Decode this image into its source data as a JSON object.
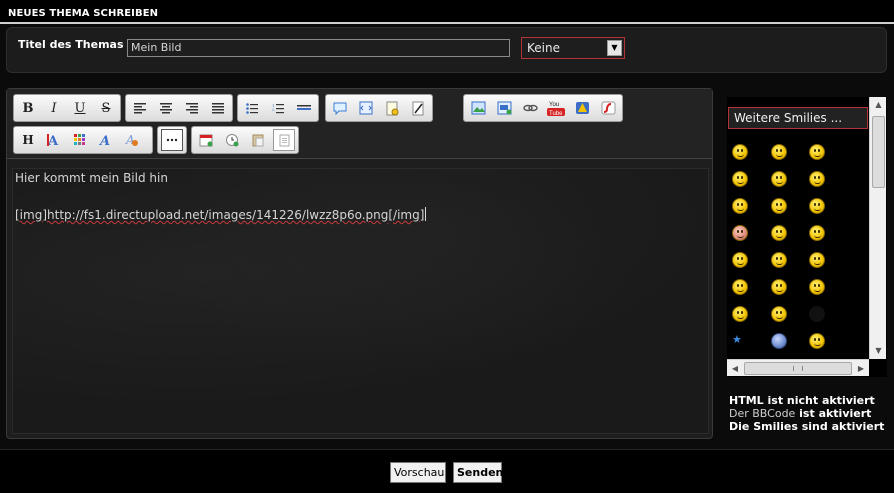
{
  "header": {
    "title": "NEUES THEMA SCHREIBEN"
  },
  "topic": {
    "label": "Titel des Themas",
    "value": "Mein Bild",
    "prefix_selected": "Keine"
  },
  "toolbar": {
    "row1": [
      {
        "group": "text-format",
        "buttons": [
          "bold",
          "italic",
          "underline",
          "strikethrough"
        ]
      },
      {
        "group": "align",
        "buttons": [
          "align-left",
          "align-center",
          "align-right",
          "justify"
        ]
      },
      {
        "group": "lists",
        "buttons": [
          "bullet-list",
          "numbered-list",
          "horizontal-rule"
        ]
      },
      {
        "group": "insert",
        "buttons": [
          "quote",
          "code",
          "note",
          "edit"
        ]
      },
      {
        "group": "media",
        "buttons": [
          "image",
          "image-upload",
          "link",
          "youtube",
          "warning",
          "flash"
        ]
      }
    ],
    "row2": [
      {
        "group": "font",
        "buttons": [
          "heading",
          "font-size",
          "color",
          "font-face",
          "remove-format"
        ]
      },
      {
        "group": "more",
        "buttons": [
          "more"
        ]
      },
      {
        "group": "tools",
        "buttons": [
          "date",
          "time",
          "paste",
          "page"
        ]
      }
    ],
    "youtube_icon_text": "You Tube"
  },
  "editor": {
    "line1": "Hier kommt mein Bild hin",
    "line2": "[img]http://fs1.directupload.net/images/141226/lwzz8p6o.png[/img]"
  },
  "smilies": {
    "more_button": "Weitere Smilies ..."
  },
  "status": {
    "html": "HTML ist nicht aktiviert",
    "bbcode_link": "Der BBCode",
    "bbcode_rest": " ist aktiviert",
    "smilies": "Die Smilies sind aktiviert"
  },
  "actions": {
    "preview": "Vorschau",
    "send": "Senden"
  }
}
